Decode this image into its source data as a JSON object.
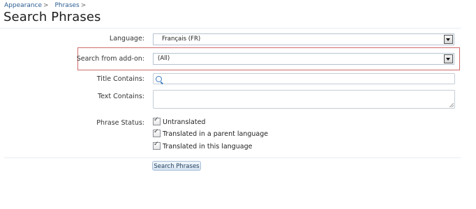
{
  "breadcrumb": [
    {
      "label": "Appearance",
      "sep": ">"
    },
    {
      "label": "Phrases",
      "sep": ">"
    }
  ],
  "page_title": "Search Phrases",
  "form": {
    "language": {
      "label": "Language:",
      "value": "Français (FR)"
    },
    "addon": {
      "label": "Search from add-on:",
      "value": "(All)"
    },
    "title_contains": {
      "label": "Title Contains:",
      "value": ""
    },
    "text_contains": {
      "label": "Text Contains:",
      "value": ""
    },
    "phrase_status": {
      "label": "Phrase Status:",
      "options": [
        {
          "label": "Untranslated",
          "checked": true
        },
        {
          "label": "Translated in a parent language",
          "checked": true
        },
        {
          "label": "Translated in this language",
          "checked": true
        }
      ]
    },
    "submit_label": "Search Phrases"
  },
  "colors": {
    "link": "#2b5d91",
    "highlight_border": "#d16b6b",
    "button_bg": "#d5e3f1"
  }
}
